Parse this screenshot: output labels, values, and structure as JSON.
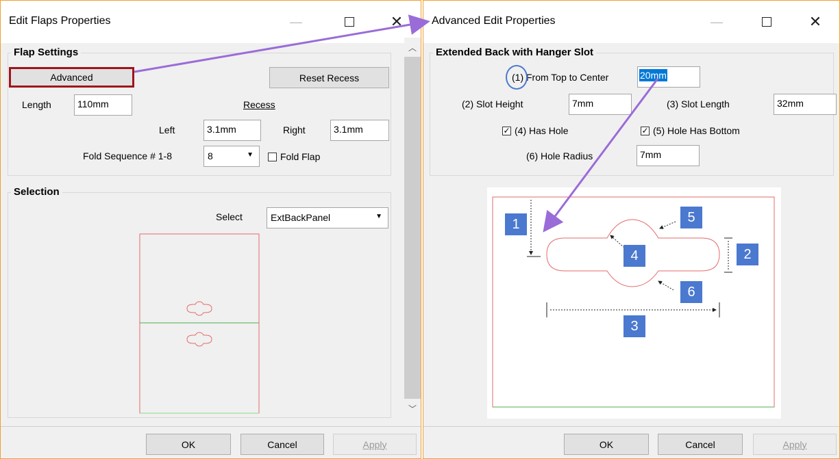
{
  "left_dialog": {
    "title": "Edit Flaps Properties",
    "flap_settings": {
      "group_label": "Flap Settings",
      "advanced_label": "Advanced",
      "reset_recess_label": "Reset Recess",
      "length_label": "Length",
      "length_value": "110mm",
      "recess_label": "Recess",
      "left_label": "Left",
      "left_value": "3.1mm",
      "right_label": "Right",
      "right_value": "3.1mm",
      "fold_seq_label": "Fold Sequence # 1-8",
      "fold_seq_value": "8",
      "fold_flap_label": "Fold Flap"
    },
    "selection": {
      "group_label": "Selection",
      "select_label": "Select",
      "select_value": "ExtBackPanel"
    },
    "footer": {
      "ok": "OK",
      "cancel": "Cancel",
      "apply": "Apply"
    }
  },
  "right_dialog": {
    "title": "Advanced Edit Properties",
    "group_label": "Extended Back with Hanger Slot",
    "from_top_label": "(1) From Top to Center",
    "from_top_value": "20mm",
    "slot_height_label": "(2) Slot Height",
    "slot_height_value": "7mm",
    "slot_length_label": "(3) Slot Length",
    "slot_length_value": "32mm",
    "has_hole_label": "(4) Has Hole",
    "hole_bottom_label": "(5) Hole Has Bottom",
    "hole_radius_label": "(6) Hole Radius",
    "hole_radius_value": "7mm",
    "diagram_badges": [
      "1",
      "2",
      "3",
      "4",
      "5",
      "6"
    ],
    "footer": {
      "ok": "OK",
      "cancel": "Cancel",
      "apply": "Apply"
    }
  },
  "colors": {
    "highlight_box": "#a0141c",
    "annotation_arrow": "#9a6cd8",
    "badge": "#4a79cf",
    "panel_outline": "#e46a6a",
    "fold_line": "#4caf50"
  },
  "icons": {
    "minimize": "minimize-icon",
    "maximize": "maximize-icon",
    "close": "close-icon",
    "dropdown": "chevron-down-icon",
    "checkbox": "checkbox-icon"
  }
}
